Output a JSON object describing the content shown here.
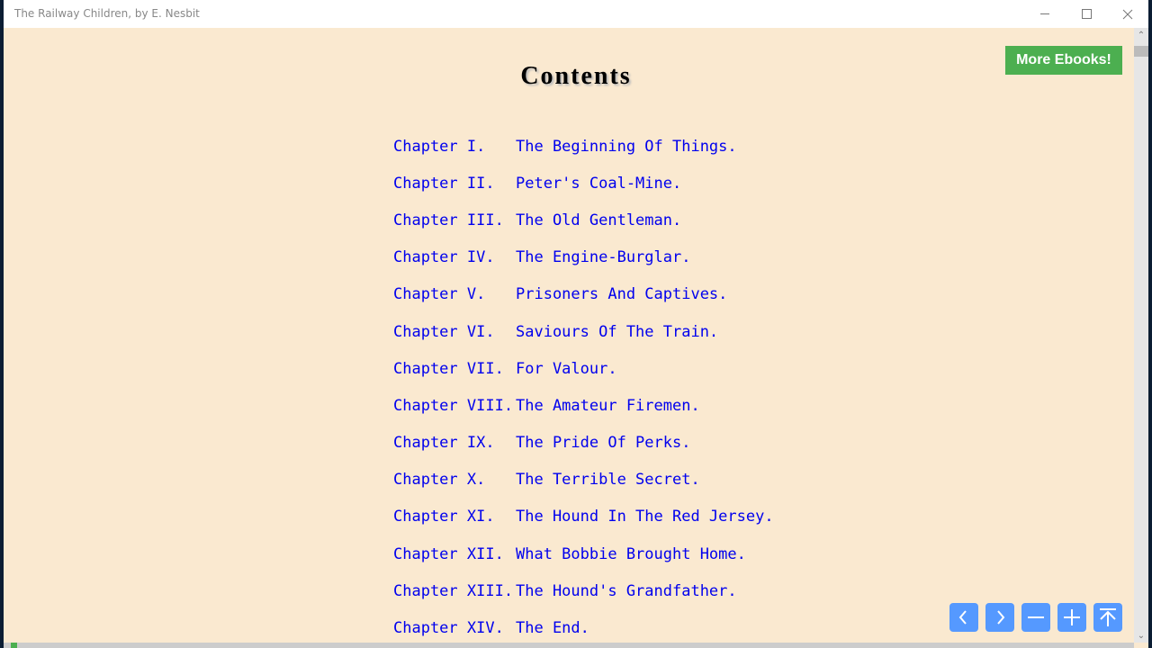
{
  "window": {
    "title": "The Railway Children, by E. Nesbit",
    "controls": {
      "minimize": "minimize",
      "maximize": "maximize",
      "close": "close"
    }
  },
  "page": {
    "heading": "Contents",
    "more_button": "More Ebooks!",
    "chapters": [
      {
        "number": "Chapter I.",
        "title": "The Beginning Of Things."
      },
      {
        "number": "Chapter II.",
        "title": "Peter's Coal-Mine."
      },
      {
        "number": "Chapter III.",
        "title": "The Old Gentleman."
      },
      {
        "number": "Chapter IV.",
        "title": "The Engine-Burglar."
      },
      {
        "number": "Chapter V.",
        "title": "Prisoners And Captives."
      },
      {
        "number": "Chapter VI.",
        "title": "Saviours Of The Train."
      },
      {
        "number": "Chapter VII.",
        "title": "For Valour."
      },
      {
        "number": "Chapter VIII.",
        "title": "The Amateur Firemen."
      },
      {
        "number": "Chapter IX.",
        "title": "The Pride Of Perks."
      },
      {
        "number": "Chapter X.",
        "title": "The Terrible Secret."
      },
      {
        "number": "Chapter XI.",
        "title": "The Hound In The Red Jersey."
      },
      {
        "number": "Chapter XII.",
        "title": "What Bobbie Brought Home."
      },
      {
        "number": "Chapter XIII.",
        "title": "The Hound's Grandfather."
      },
      {
        "number": "Chapter XIV.",
        "title": "The End."
      }
    ]
  },
  "nav_buttons": [
    {
      "name": "previous-page",
      "icon": "chevron-left-icon"
    },
    {
      "name": "next-page",
      "icon": "chevron-right-icon"
    },
    {
      "name": "zoom-out",
      "icon": "minus-icon"
    },
    {
      "name": "zoom-in",
      "icon": "plus-icon"
    },
    {
      "name": "scroll-to-top",
      "icon": "arrow-to-top-icon"
    }
  ],
  "colors": {
    "page_background": "#fae9d0",
    "link": "#0000ee",
    "accent_green": "#4caf50",
    "nav_blue": "#5599ff"
  },
  "reading_progress": 0.005
}
